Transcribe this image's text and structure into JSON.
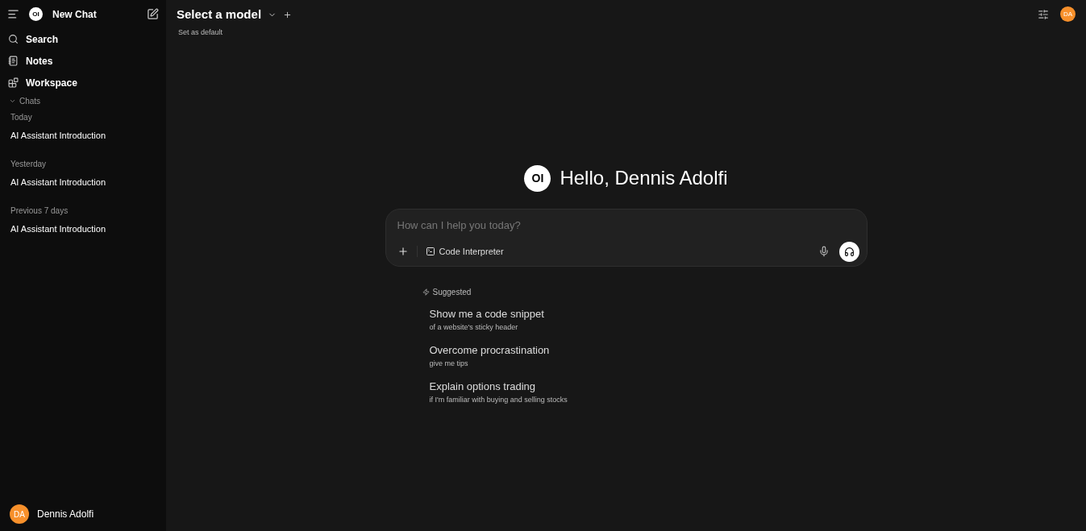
{
  "sidebar": {
    "logo": "OI",
    "title": "New Chat",
    "nav": [
      {
        "kind": "search",
        "label": "Search"
      },
      {
        "kind": "notes",
        "label": "Notes"
      },
      {
        "kind": "workspace",
        "label": "Workspace"
      }
    ],
    "chats": {
      "label": "Chats",
      "expanded": true,
      "groups": [
        {
          "label": "Today",
          "items": [
            "AI Assistant Introduction"
          ]
        },
        {
          "label": "Yesterday",
          "items": [
            "AI Assistant Introduction"
          ]
        },
        {
          "label": "Previous 7 days",
          "items": [
            "AI Assistant Introduction"
          ]
        }
      ]
    },
    "user": {
      "initials": "DA",
      "name": "Dennis Adolfi"
    }
  },
  "header": {
    "model": "Select a model",
    "default_link": "Set as default",
    "avatar": "DA"
  },
  "greeting": {
    "logo": "OI",
    "text": "Hello, Dennis Adolfi"
  },
  "composer": {
    "placeholder": "How can I help you today?",
    "tool": "Code Interpreter"
  },
  "suggested": {
    "label": "Suggested",
    "items": [
      {
        "title": "Show me a code snippet",
        "subtitle": "of a website's sticky header"
      },
      {
        "title": "Overcome procrastination",
        "subtitle": "give me tips"
      },
      {
        "title": "Explain options trading",
        "subtitle": "if I'm familiar with buying and selling stocks"
      }
    ]
  }
}
